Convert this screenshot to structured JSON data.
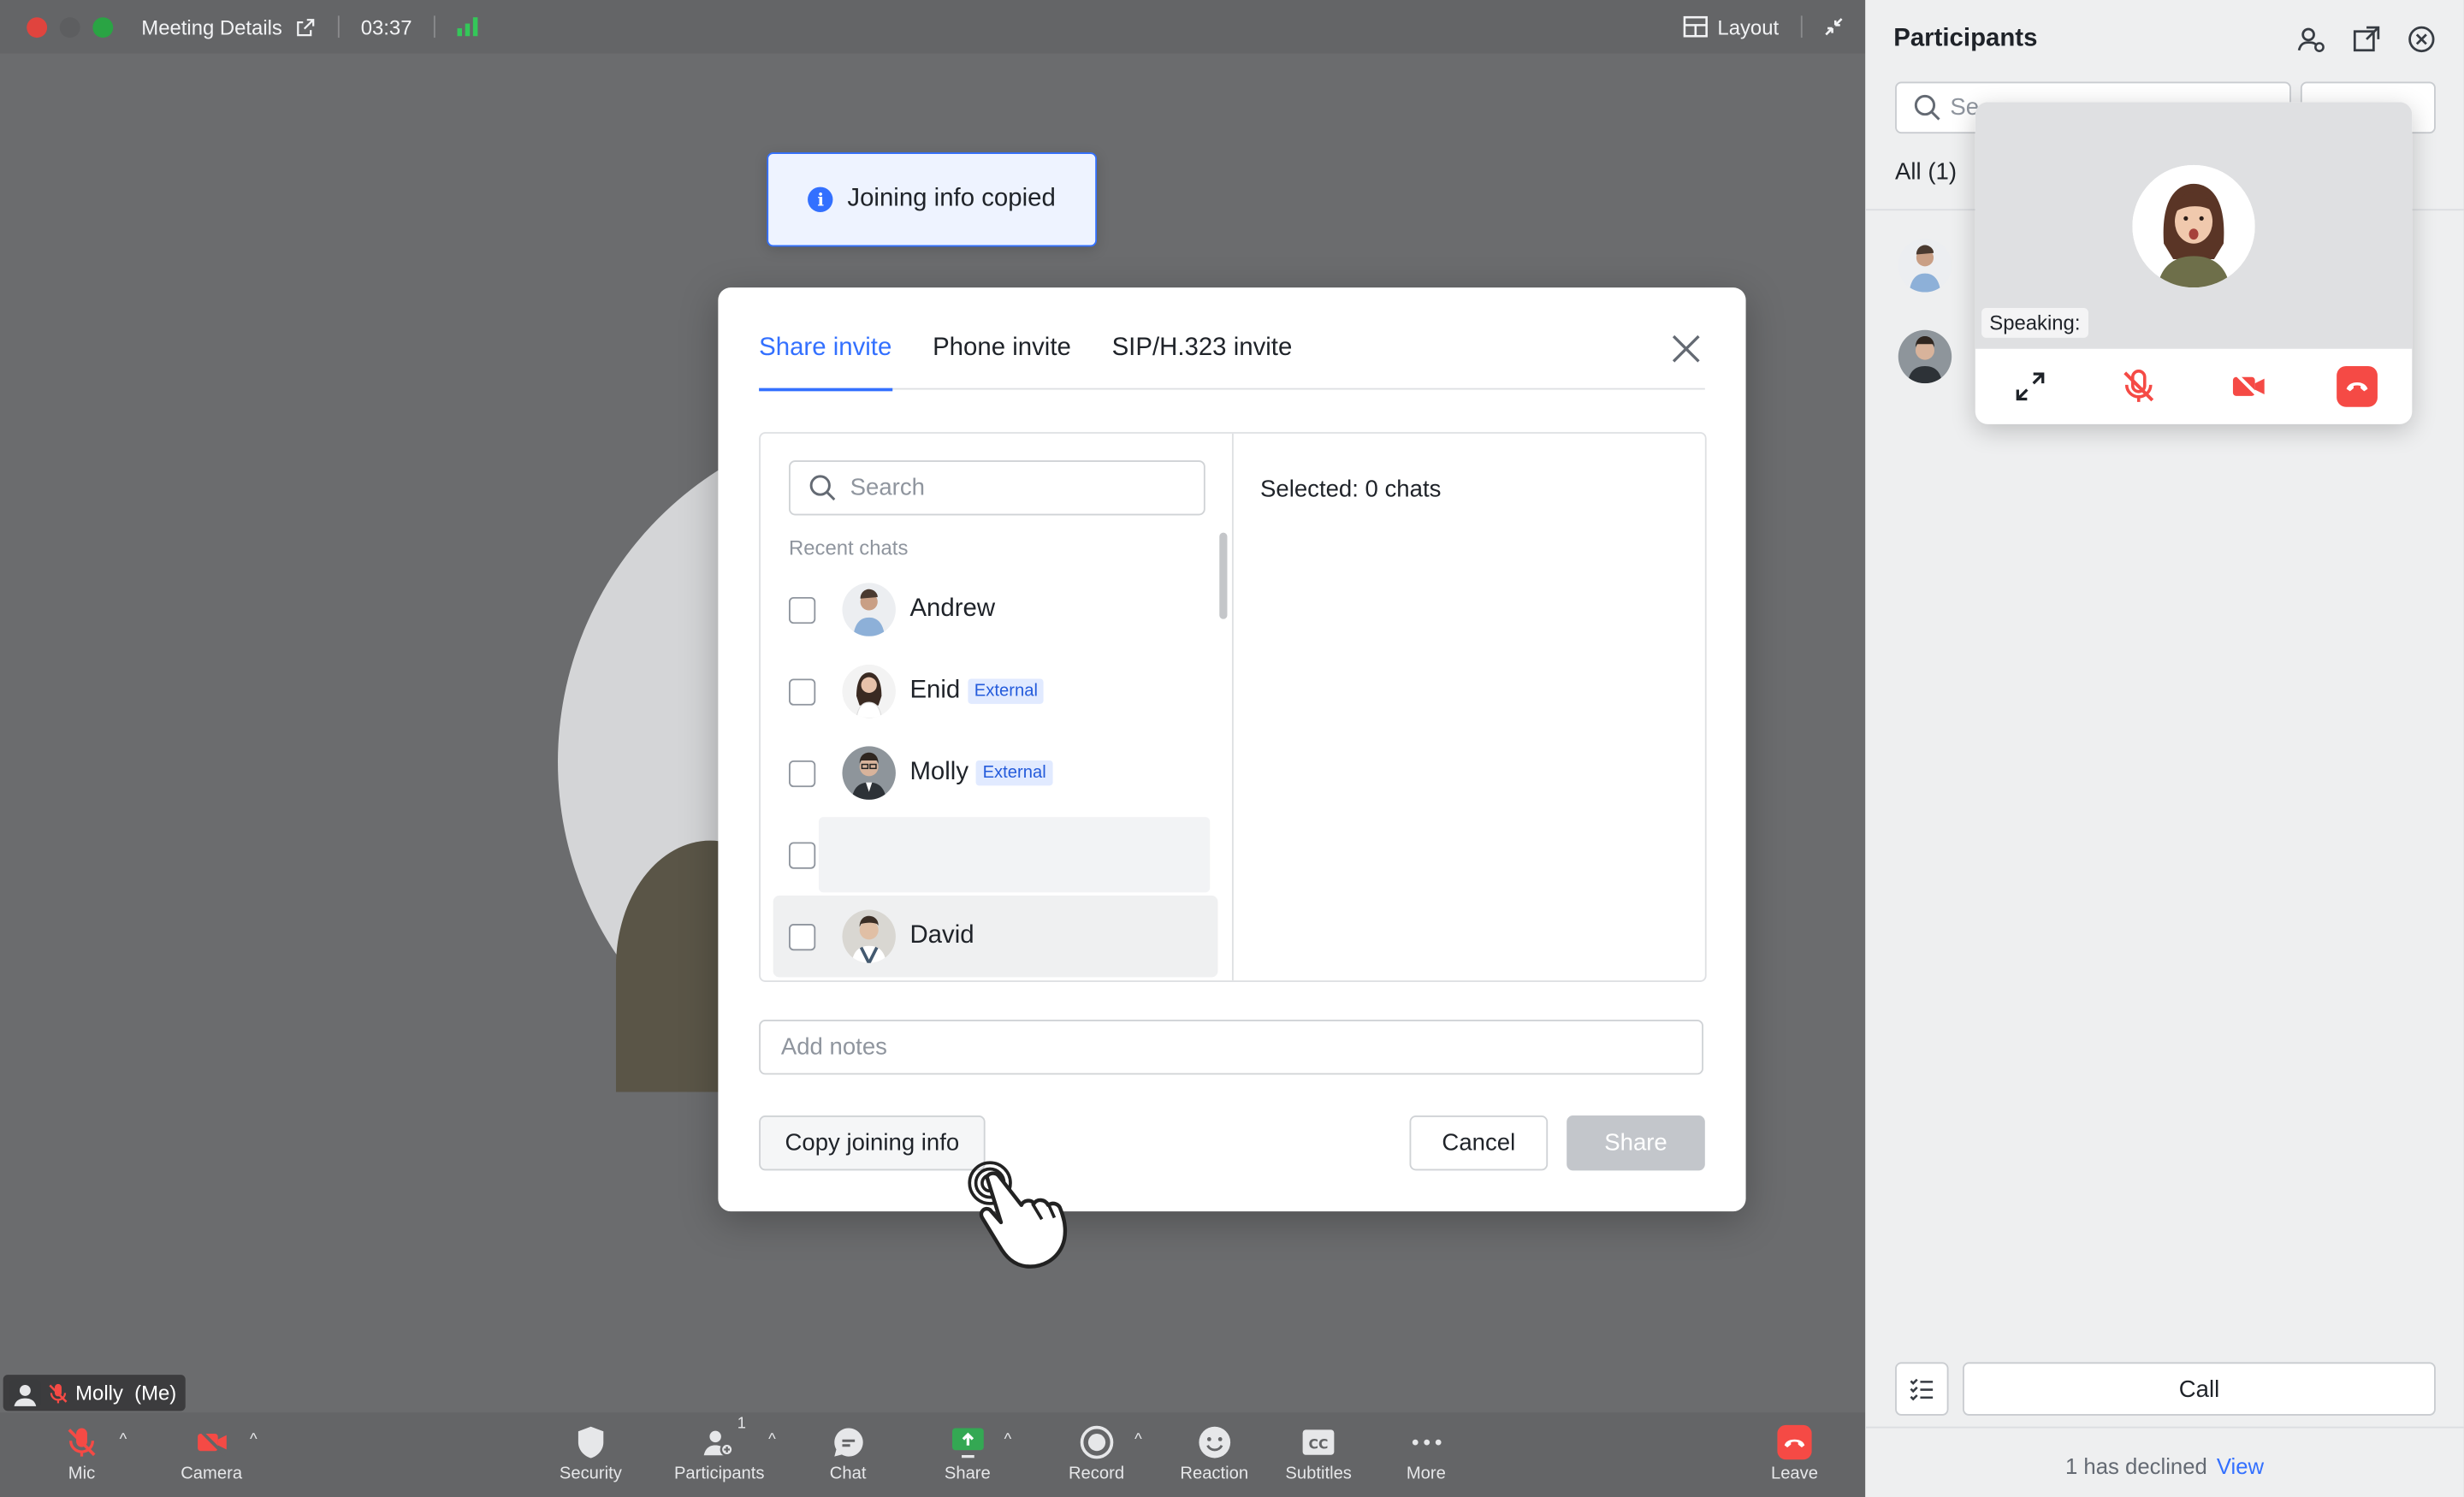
{
  "titlebar": {
    "title": "Meeting Details",
    "time": "03:37",
    "layout_label": "Layout"
  },
  "toast": {
    "message": "Joining info copied"
  },
  "modal": {
    "tabs": [
      {
        "label": "Share invite",
        "active": true
      },
      {
        "label": "Phone invite",
        "active": false
      },
      {
        "label": "SIP/H.323 invite",
        "active": false
      }
    ],
    "search_placeholder": "Search",
    "recent_label": "Recent chats",
    "chats": [
      {
        "name": "Andrew",
        "tag": ""
      },
      {
        "name": "Enid",
        "tag": "External"
      },
      {
        "name": "Molly",
        "tag": "External"
      },
      {
        "name": "",
        "tag": ""
      },
      {
        "name": "David",
        "tag": ""
      }
    ],
    "selected_label": "Selected: 0 chats",
    "notes_placeholder": "Add notes",
    "copy_button": "Copy joining info",
    "cancel_button": "Cancel",
    "share_button": "Share"
  },
  "self_label": "Molly  (Me)",
  "toolbar": {
    "mic": "Mic",
    "camera": "Camera",
    "security": "Security",
    "participants": "Participants",
    "participants_count": "1",
    "chat": "Chat",
    "share": "Share",
    "record": "Record",
    "reaction": "Reaction",
    "subtitles": "Subtitles",
    "more": "More",
    "leave": "Leave"
  },
  "panel": {
    "title": "Participants",
    "search_partial": "Se",
    "all_label": "All (1)",
    "call_button": "Call",
    "declined_text": "1 has declined",
    "view_link": "View"
  },
  "float_card": {
    "speaking_label": "Speaking:"
  },
  "colors": {
    "accent": "#3370ff",
    "danger": "#f54a45",
    "share_green": "#34a853"
  }
}
